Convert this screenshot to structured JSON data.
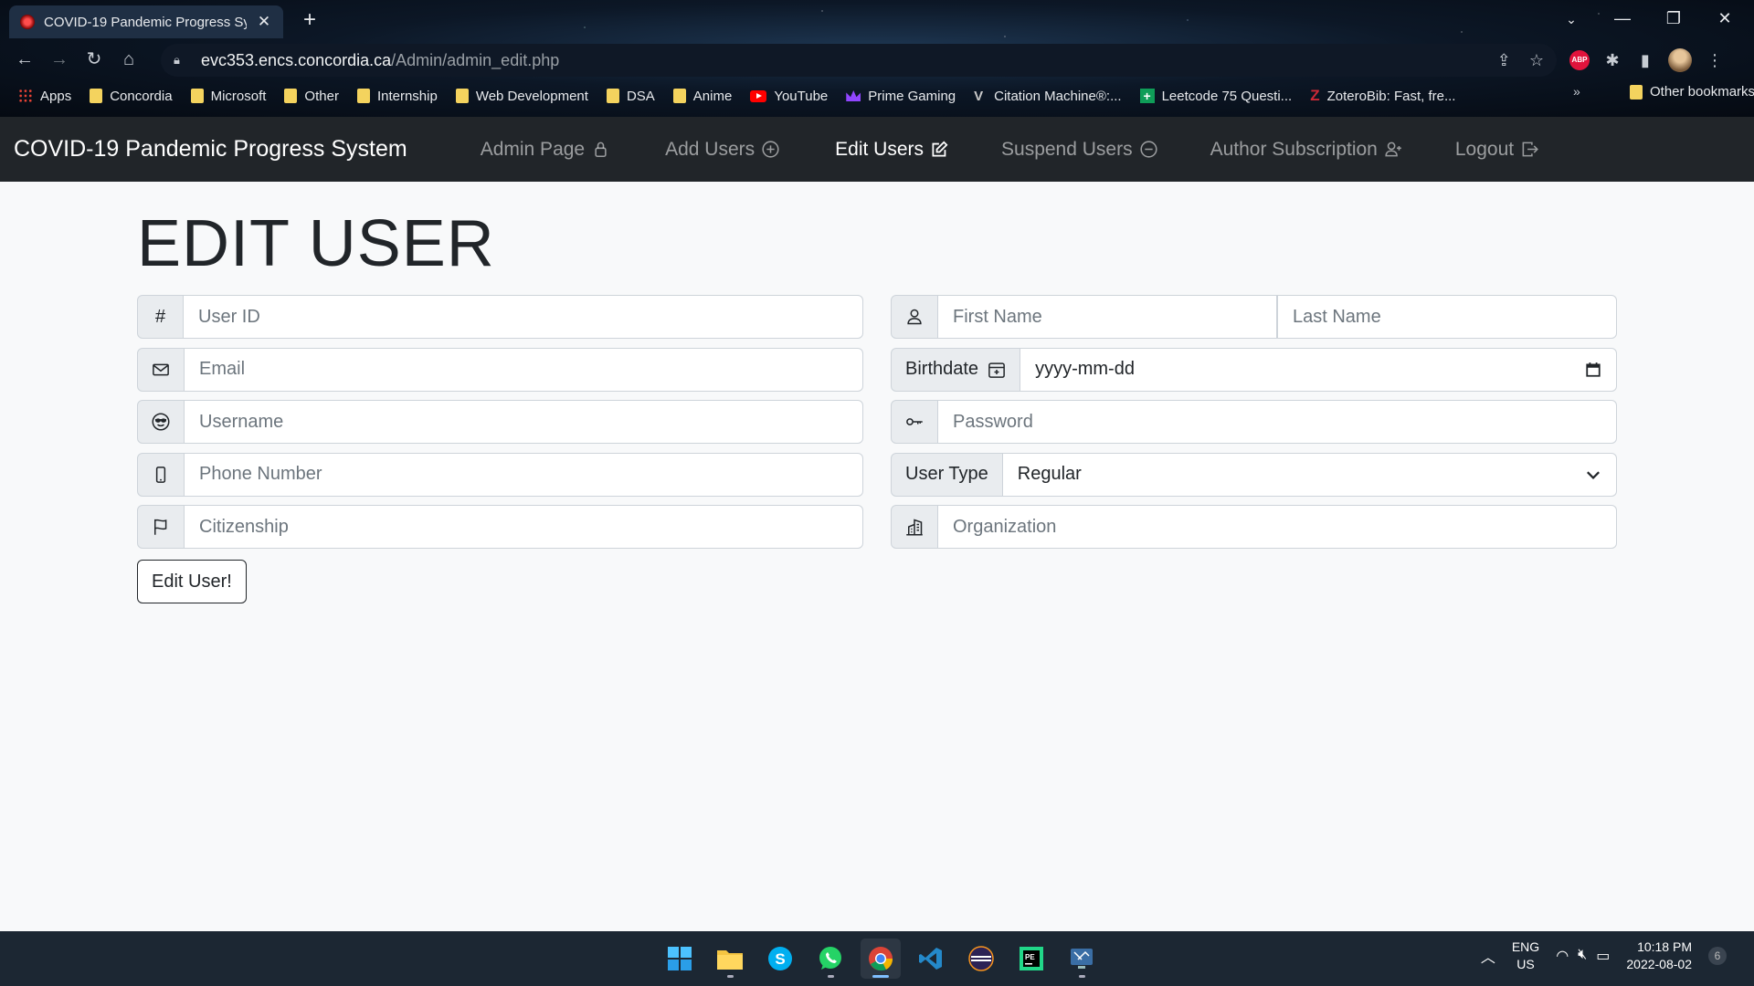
{
  "browser": {
    "tab_title": "COVID-19 Pandemic Progress Sy",
    "url_host": "evc353.encs.concordia.ca",
    "url_path": "/Admin/admin_edit.php",
    "bookmarks": [
      {
        "label": "Apps",
        "icon": "apps-grid-icon"
      },
      {
        "label": "Concordia",
        "icon": "folder-icon"
      },
      {
        "label": "Microsoft",
        "icon": "folder-icon"
      },
      {
        "label": "Other",
        "icon": "folder-icon"
      },
      {
        "label": "Internship",
        "icon": "folder-icon"
      },
      {
        "label": "Web Development",
        "icon": "folder-icon"
      },
      {
        "label": "DSA",
        "icon": "folder-icon"
      },
      {
        "label": "Anime",
        "icon": "folder-icon"
      },
      {
        "label": "YouTube",
        "icon": "youtube-icon"
      },
      {
        "label": "Prime Gaming",
        "icon": "crown-icon"
      },
      {
        "label": "Citation Machine®:...",
        "icon": "citation-icon"
      },
      {
        "label": "Leetcode 75 Questi...",
        "icon": "sheets-icon"
      },
      {
        "label": "ZoteroBib: Fast, fre...",
        "icon": "zotero-icon"
      }
    ],
    "other_bookmarks": "Other bookmarks",
    "extension_abp": "ABP"
  },
  "navbar": {
    "brand": "COVID-19 Pandemic Progress System",
    "links": [
      {
        "label": "Admin Page",
        "icon": "lock-icon",
        "active": false
      },
      {
        "label": "Add Users",
        "icon": "plus-circle-icon",
        "active": false
      },
      {
        "label": "Edit Users",
        "icon": "edit-icon",
        "active": true
      },
      {
        "label": "Suspend Users",
        "icon": "dash-circle-icon",
        "active": false
      },
      {
        "label": "Author Subscription",
        "icon": "person-plus-icon",
        "active": false
      },
      {
        "label": "Logout",
        "icon": "logout-icon",
        "active": false
      }
    ]
  },
  "page": {
    "title": "EDIT USER",
    "user_id_symbol": "#",
    "fields_left": {
      "user_id": "User ID",
      "email": "Email",
      "username": "Username",
      "phone": "Phone Number",
      "citizenship": "Citizenship"
    },
    "fields_right": {
      "first_name": "First Name",
      "last_name": "Last Name",
      "birthdate_label": "Birthdate",
      "birthdate_value": "yyyy-mm-dd",
      "password": "Password",
      "user_type_label": "User Type",
      "user_type_value": "Regular",
      "organization": "Organization"
    },
    "submit": "Edit User!"
  },
  "taskbar": {
    "lang_line1": "ENG",
    "lang_line2": "US",
    "time": "10:18 PM",
    "date": "2022-08-02",
    "notification_count": "6"
  },
  "colors": {
    "navbar_bg": "#212529",
    "page_bg": "#f8f9fa",
    "addon_bg": "#e9ecef",
    "border": "#ced4da"
  }
}
